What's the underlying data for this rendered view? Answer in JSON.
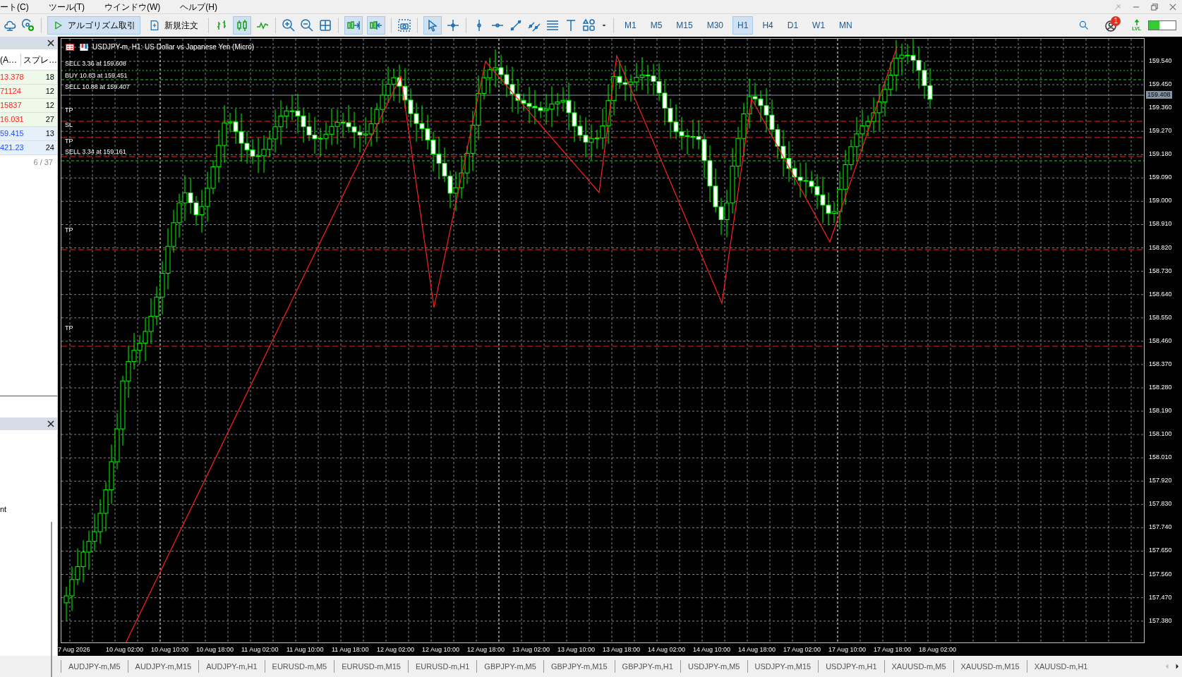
{
  "menu": [
    "ート(C)",
    "ツール(T)",
    "ウインドウ(W)",
    "ヘルプ(H)"
  ],
  "toolbar": {
    "algo_button": "アルゴリズム取引",
    "new_order_button": "新規注文",
    "timeframes": [
      {
        "label": "M1",
        "selected": false
      },
      {
        "label": "M5",
        "selected": false
      },
      {
        "label": "M15",
        "selected": false
      },
      {
        "label": "M30",
        "selected": false
      },
      {
        "label": "H1",
        "selected": true
      },
      {
        "label": "H4",
        "selected": false
      },
      {
        "label": "D1",
        "selected": false
      },
      {
        "label": "W1",
        "selected": false
      },
      {
        "label": "MN",
        "selected": false
      }
    ],
    "notification_count": "1",
    "signal_label": "LVL",
    "meter": {
      "level": 0.4
    }
  },
  "market_watch": {
    "columns": [
      "(A…",
      "スプレ…"
    ],
    "rows": [
      {
        "price": "13.378",
        "spread": "18",
        "color": "#ff2020"
      },
      {
        "price": "71124",
        "spread": "12",
        "color": "#ff2020"
      },
      {
        "price": "15837",
        "spread": "12",
        "color": "#ff2020"
      },
      {
        "price": "16.031",
        "spread": "27",
        "color": "#ff2020"
      },
      {
        "price": "59.415",
        "spread": "13",
        "color": "#2050ff"
      },
      {
        "price": "421.23",
        "spread": "24",
        "color": "#2050ff"
      }
    ],
    "footer": "6 / 37"
  },
  "lower_panel": {
    "text": "nt"
  },
  "chart": {
    "title": "USDJPY-m, H1:  US Dollar vs Japanese Yen (Micro)",
    "trade_labels": [
      "SELL 3.36 at 159.608",
      "BUY 10.83 at 159.451",
      "SELL 10.88 at 159.407",
      "SELL 3.34 at 159.161"
    ],
    "level_labels": [
      "TP",
      "SL",
      "TP",
      "TP",
      "TP"
    ],
    "price_axis": [
      "159.540",
      "159.450",
      "159.360",
      "159.270",
      "159.180",
      "159.090",
      "159.000",
      "158.910",
      "158.820",
      "158.730",
      "158.640",
      "158.550",
      "158.460",
      "158.370",
      "158.280",
      "158.190",
      "158.100",
      "158.010",
      "157.920",
      "157.830",
      "157.740",
      "157.650",
      "157.560",
      "157.470",
      "157.380"
    ],
    "current_price": "159.408",
    "time_axis": [
      "7 Aug 2026",
      "10 Aug 02:00",
      "10 Aug 10:00",
      "10 Aug 18:00",
      "11 Aug 02:00",
      "11 Aug 10:00",
      "11 Aug 18:00",
      "12 Aug 02:00",
      "12 Aug 10:00",
      "12 Aug 18:00",
      "13 Aug 02:00",
      "13 Aug 10:00",
      "13 Aug 18:00",
      "14 Aug 02:00",
      "14 Aug 10:00",
      "14 Aug 18:00",
      "17 Aug 02:00",
      "17 Aug 10:00",
      "17 Aug 18:00",
      "18 Aug 02:00"
    ]
  },
  "symbol_tabs": [
    "AUDJPY-m,M5",
    "AUDJPY-m,M15",
    "AUDJPY-m,H1",
    "EURUSD-m,M5",
    "EURUSD-m,M15",
    "EURUSD-m,H1",
    "GBPJPY-m,M5",
    "GBPJPY-m,M15",
    "GBPJPY-m,H1",
    "USDJPY-m,M5",
    "USDJPY-m,M15",
    "USDJPY-m,H1",
    "XAUUSD-m,M5",
    "XAUUSD-m,M15",
    "XAUUSD-m,H1"
  ]
}
